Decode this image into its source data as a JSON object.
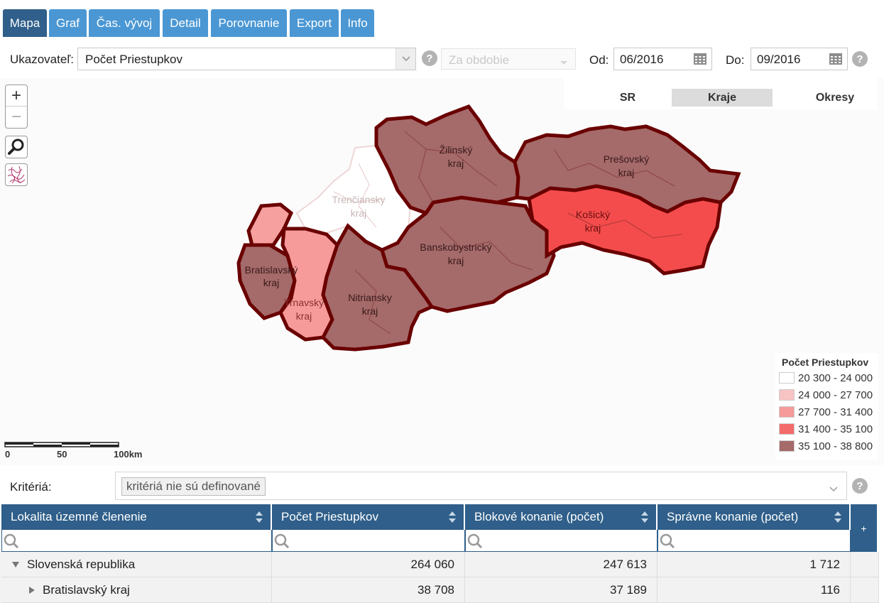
{
  "tabs": [
    {
      "label": "Mapa",
      "active": true
    },
    {
      "label": "Graf",
      "active": false
    },
    {
      "label": "Čas. vývoj",
      "active": false
    },
    {
      "label": "Detail",
      "active": false
    },
    {
      "label": "Porovnanie",
      "active": false
    },
    {
      "label": "Export",
      "active": false
    },
    {
      "label": "Info",
      "active": false
    }
  ],
  "filters": {
    "indicator_label": "Ukazovateľ:",
    "indicator_value": "Počet Priestupkov",
    "period_placeholder": "Za obdobie",
    "from_label": "Od:",
    "from_value": "06/2016",
    "to_label": "Do:",
    "to_value": "09/2016",
    "help": "?"
  },
  "map": {
    "zoom_in": "+",
    "zoom_out": "−",
    "levels": [
      {
        "label": "SR",
        "active": false
      },
      {
        "label": "Kraje",
        "active": true
      },
      {
        "label": "Okresy",
        "active": false
      }
    ],
    "regions": [
      {
        "name": "Žilinský",
        "suffix": "kraj"
      },
      {
        "name": "Prešovský",
        "suffix": "kraj"
      },
      {
        "name": "Trenčiansky",
        "suffix": "kraj"
      },
      {
        "name": "Banskobystrický",
        "suffix": "kraj"
      },
      {
        "name": "Košický",
        "suffix": "kraj"
      },
      {
        "name": "Bratislavský",
        "suffix": "kraj"
      },
      {
        "name": "Nitriansky",
        "suffix": "kraj"
      },
      {
        "name": "Trnavský",
        "suffix": "kraj"
      }
    ],
    "legend": {
      "title": "Počet Priestupkov",
      "items": [
        {
          "label": "20 300 - 24 000",
          "color": "#ffffff"
        },
        {
          "label": "24 000 - 27 700",
          "color": "#f8c3c3"
        },
        {
          "label": "27 700 - 31 400",
          "color": "#f79a9a"
        },
        {
          "label": "31 400 - 35 100",
          "color": "#f46b6b"
        },
        {
          "label": "35 100 - 38 800",
          "color": "#a56a6a"
        }
      ]
    },
    "scale": {
      "l0": "0",
      "l1": "50",
      "l2": "100km"
    }
  },
  "criteria": {
    "label": "Kritériá:",
    "tag": "kritériá nie sú definované"
  },
  "table": {
    "columns": [
      "Lokalita územné členenie",
      "Počet Priestupkov",
      "Blokové konanie (počet)",
      "Správne konanie (počet)"
    ],
    "add_column": "+",
    "rows": [
      {
        "name": "Slovenská republika",
        "v1": "264 060",
        "v2": "247 613",
        "v3": "1 712"
      },
      {
        "name": "Bratislavský kraj",
        "v1": "38 708",
        "v2": "37 189",
        "v3": "116"
      }
    ]
  }
}
